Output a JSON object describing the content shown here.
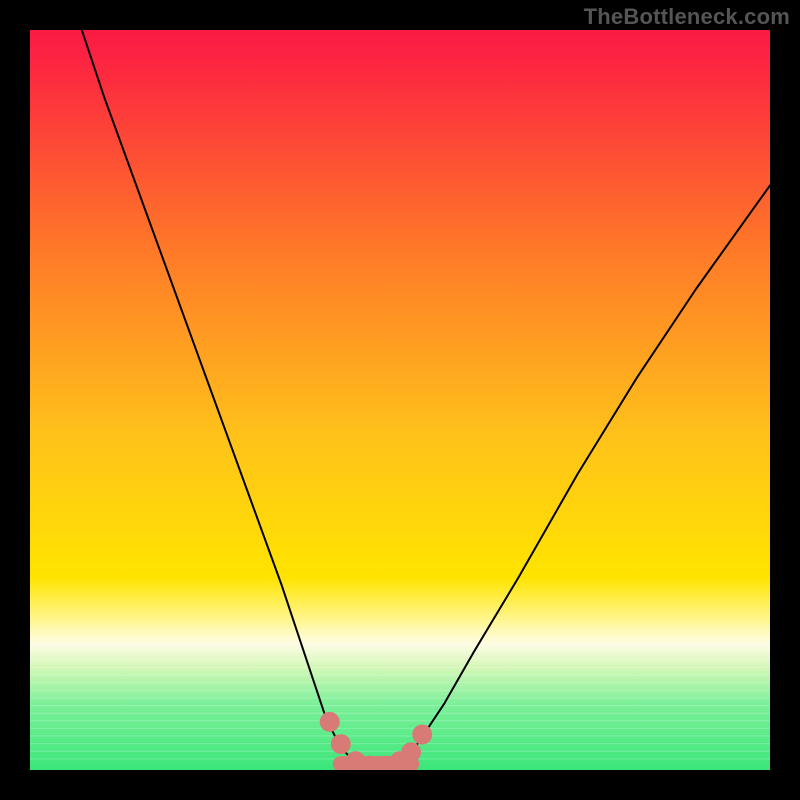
{
  "watermark": "TheBottleneck.com",
  "chart_data": {
    "type": "line",
    "title": "",
    "xlabel": "",
    "ylabel": "",
    "xlim": [
      0,
      100
    ],
    "ylim": [
      0,
      100
    ],
    "grid": false,
    "legend": false,
    "annotations": [],
    "background_gradient": {
      "top": "#fb1a45",
      "mid": "#ffe400",
      "green_band": "#3be67a",
      "green_top_y": 83,
      "near_white_y": 81,
      "near_white": "#fdfce4"
    },
    "series": [
      {
        "name": "bottleneck-curve",
        "color": "#000000",
        "width": 2,
        "x": [
          7,
          10,
          14,
          18,
          22,
          26,
          30,
          34,
          38,
          40,
          42,
          44,
          46,
          48,
          50,
          52,
          56,
          60,
          66,
          74,
          82,
          90,
          100
        ],
        "y": [
          100,
          91,
          80,
          69,
          58,
          47,
          36,
          25,
          13,
          7,
          3,
          1,
          0.5,
          0.5,
          1,
          3,
          9,
          16,
          26,
          40,
          53,
          65,
          79
        ]
      },
      {
        "name": "optimal-zone-markers",
        "color": "#d87b77",
        "marker_size": 10,
        "x": [
          40.5,
          42,
          44,
          46,
          48,
          50,
          51.5,
          53
        ],
        "y": [
          6.5,
          3.5,
          1.2,
          0.6,
          0.6,
          1.2,
          2.4,
          4.8
        ]
      }
    ],
    "optimal_band": {
      "color": "#d87b77",
      "x_start": 42,
      "x_end": 51.5,
      "y": 0.8,
      "thickness_px": 16
    }
  }
}
